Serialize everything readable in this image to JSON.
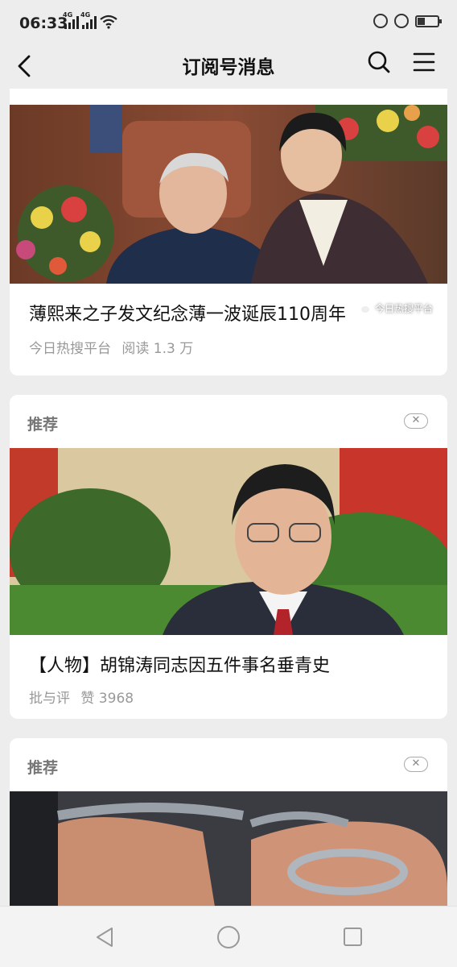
{
  "status_bar": {
    "time": "06:33",
    "signal_1_label": "4G",
    "signal_2_label": "4G"
  },
  "header": {
    "title": "订阅号消息",
    "icons": [
      "back-arrow-icon",
      "search-icon",
      "menu-icon"
    ]
  },
  "articles": [
    {
      "title": "薄熙来之子发文纪念薄一波诞辰110周年",
      "source": "今日热搜平台",
      "stats": "阅读 1.3 万",
      "watermark": "今日热搜平台"
    },
    {
      "tag": "推荐",
      "title": "【人物】胡锦涛同志因五件事名垂青史",
      "source": "批与评",
      "stats": "赞 3968"
    },
    {
      "tag": "推荐"
    }
  ],
  "colors": {
    "background": "#ededed",
    "card": "#ffffff",
    "meta_text": "#999999"
  }
}
